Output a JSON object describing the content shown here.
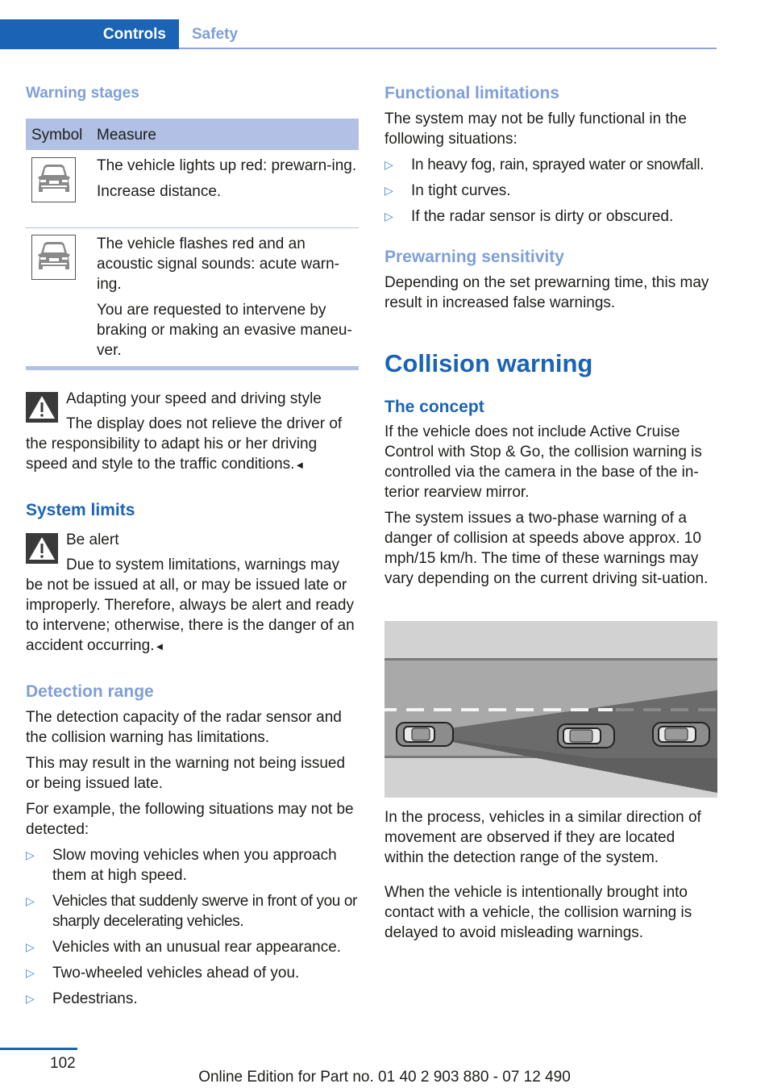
{
  "header": {
    "section_active": "Controls",
    "section_next": "Safety"
  },
  "left": {
    "warning_stages_heading": "Warning stages",
    "table": {
      "col_symbol": "Symbol",
      "col_measure": "Measure",
      "rows": [
        {
          "icon": "car-rear-icon",
          "lines": [
            "The vehicle lights up red: prewarn-ing.",
            "Increase distance."
          ]
        },
        {
          "icon": "car-rear-icon",
          "lines": [
            "The vehicle flashes red and an acoustic signal sounds: acute warn-ing.",
            "You are requested to intervene by braking or making an evasive maneu-ver."
          ]
        }
      ]
    },
    "warning1": {
      "icon": "warning-triangle-icon",
      "title": "Adapting your speed and driving style",
      "body": "The display does not relieve the driver of the responsibility to adapt his or her driving speed and style to the traffic conditions.",
      "end_mark": "◄"
    },
    "system_limits_heading": "System limits",
    "warning2": {
      "icon": "warning-triangle-icon",
      "title": "Be alert",
      "body": "Due to system limitations, warnings may be not be issued at all, or may be issued late or improperly. Therefore, always be alert and ready to intervene; otherwise, there is the danger of an accident occurring.",
      "end_mark": "◄"
    },
    "detection_range": {
      "heading": "Detection range",
      "p1": "The detection capacity of the radar sensor and the collision warning has limitations.",
      "p2": "This may result in the warning not being issued or being issued late.",
      "p3": "For example, the following situations may not be detected:",
      "bullet_glyph": "▷",
      "items": [
        "Slow moving vehicles when you approach them at high speed.",
        "Vehicles that suddenly swerve in front of you or sharply decelerating vehicles.",
        "Vehicles with an unusual rear appearance.",
        "Two-wheeled vehicles ahead of you.",
        "Pedestrians."
      ]
    }
  },
  "right": {
    "functional_limitations": {
      "heading": "Functional limitations",
      "intro": "The system may not be fully functional in the following situations:",
      "bullet_glyph": "▷",
      "items": [
        "In heavy fog, rain, sprayed water or snowfall.",
        "In tight curves.",
        "If the radar sensor is dirty or obscured."
      ]
    },
    "prewarning_sensitivity": {
      "heading": "Prewarning sensitivity",
      "body": "Depending on the set prewarning time, this may result in increased false warnings."
    },
    "collision_warning_title": "Collision warning",
    "concept": {
      "heading": "The concept",
      "p1": "If the vehicle does not include Active Cruise Control with Stop & Go, the collision warning is controlled via the camera in the base of the in-terior rearview mirror.",
      "p2": "The system issues a two-phase warning of a danger of collision at speeds above approx. 10 mph/15 km/h. The time of these warnings may vary depending on the current driving sit-uation."
    },
    "illustration": {
      "description": "road-detection-range-illustration"
    },
    "p3": "In the process, vehicles in a similar direction of movement are observed if they are located within the detection range of the system.",
    "p4": "When the vehicle is intentionally brought into contact with a vehicle, the collision warning is delayed to avoid misleading warnings."
  },
  "footer": {
    "page_number": "102",
    "edition": "Online Edition for Part no. 01 40 2 903 880 - 07 12 490"
  }
}
